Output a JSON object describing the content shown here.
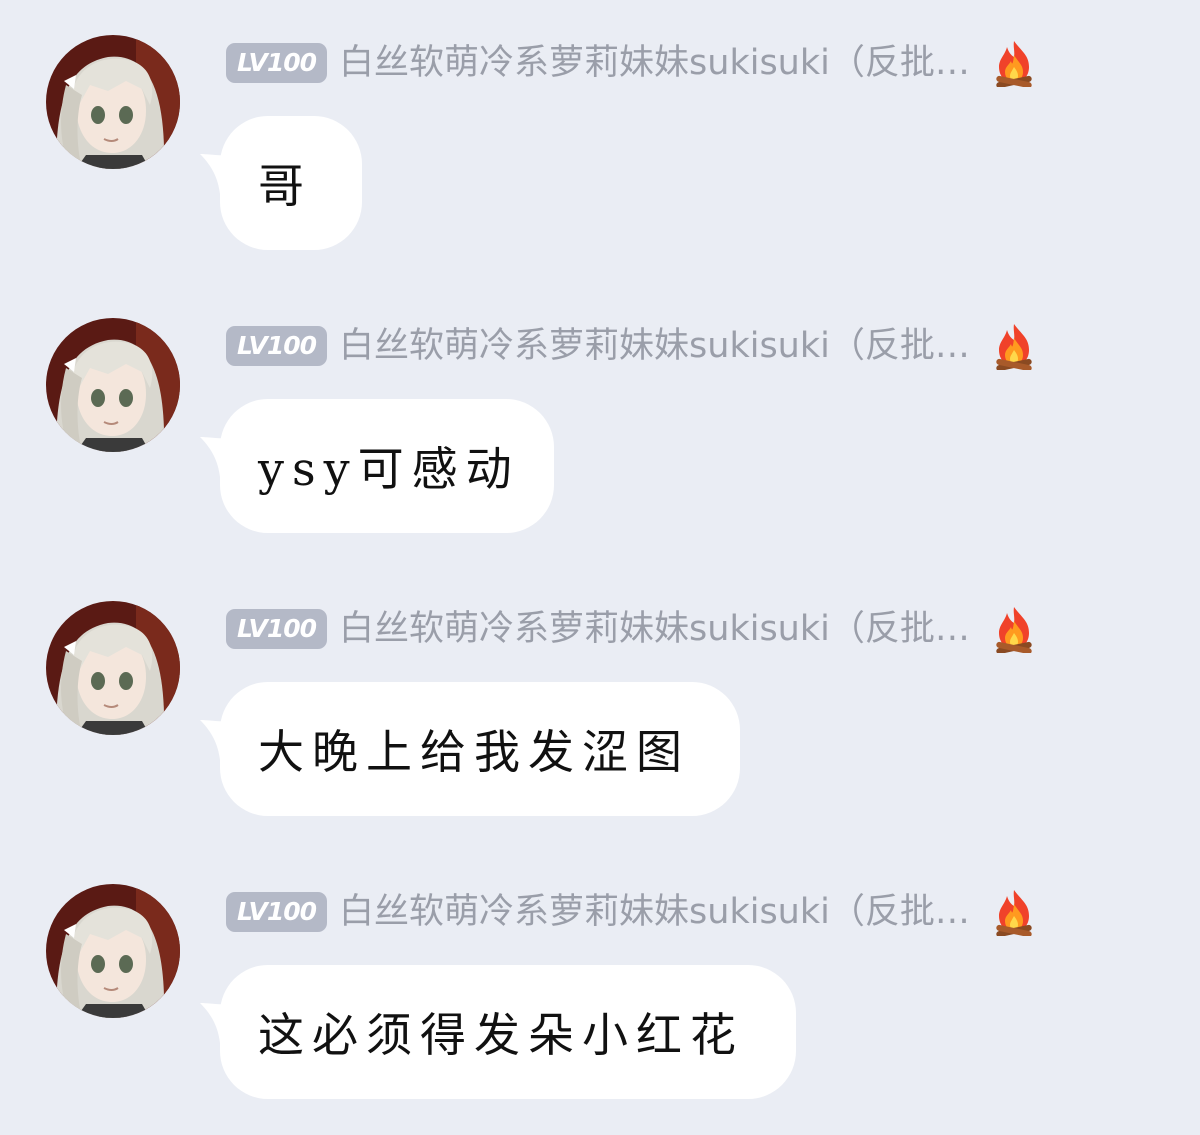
{
  "messages": [
    {
      "level": "LV100",
      "nickname": "白丝软萌冷系萝莉妹妹sukisuki（反批…",
      "text": "哥"
    },
    {
      "level": "LV100",
      "nickname": "白丝软萌冷系萝莉妹妹sukisuki（反批…",
      "text": "ysy可感动"
    },
    {
      "level": "LV100",
      "nickname": "白丝软萌冷系萝莉妹妹sukisuki（反批…",
      "text": "大晚上给我发涩图"
    },
    {
      "level": "LV100",
      "nickname": "白丝软萌冷系萝莉妹妹sukisuki（反批…",
      "text": "这必须得发朵小红花"
    }
  ],
  "colors": {
    "background": "#eaedf4",
    "bubble": "#ffffff",
    "badge": "#b4b9c7",
    "nickname": "#9a9ea9"
  },
  "icons": {
    "badge_flame": "fire-icon"
  }
}
